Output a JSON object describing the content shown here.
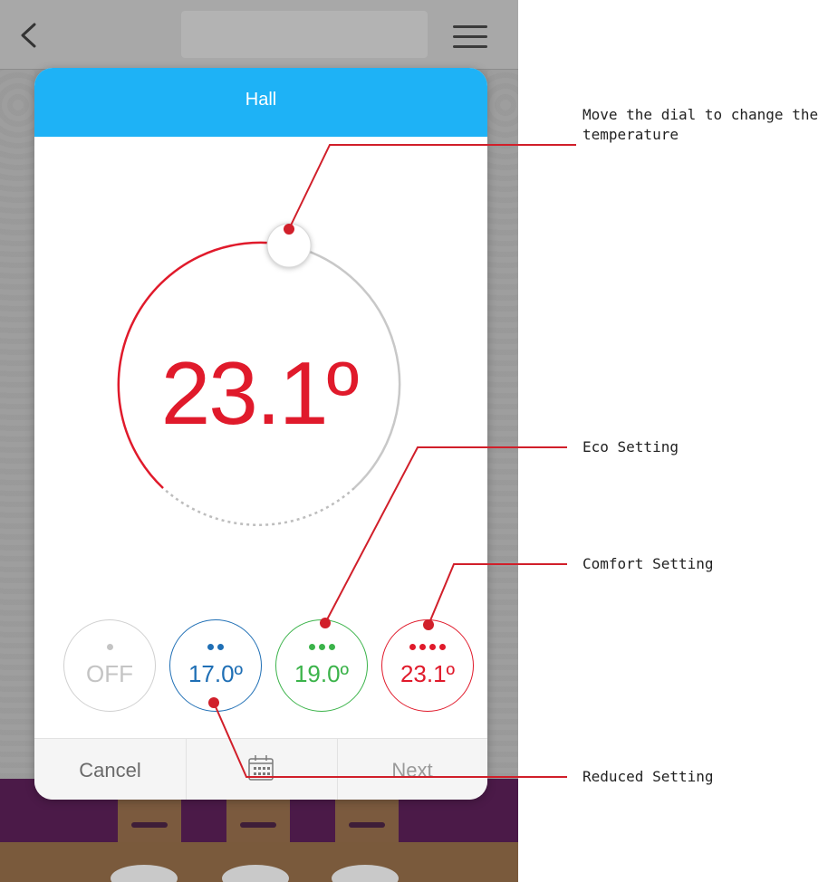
{
  "room": {
    "title": "Hall"
  },
  "dial": {
    "temperature": "23.1º"
  },
  "settings": [
    {
      "id": "off",
      "dots": 1,
      "value": "OFF",
      "color": "#c4c4c4"
    },
    {
      "id": "reduced",
      "dots": 2,
      "value": "17.0º",
      "color": "#1f6fb5"
    },
    {
      "id": "eco",
      "dots": 3,
      "value": "19.0º",
      "color": "#3bb34a"
    },
    {
      "id": "comfort",
      "dots": 4,
      "value": "23.1º",
      "color": "#e01a2b"
    }
  ],
  "bottom_bar": {
    "cancel_label": "Cancel",
    "next_label": "Next"
  },
  "annotations": {
    "dial_line1": "Move the dial to change the",
    "dial_line2": "temperature",
    "eco": "Eco Setting",
    "comfort": "Comfort Setting",
    "reduced": "Reduced Setting"
  },
  "colors": {
    "header": "#1eb2f6",
    "accent": "#e01a2b",
    "annotation_line": "#d11f2a"
  }
}
